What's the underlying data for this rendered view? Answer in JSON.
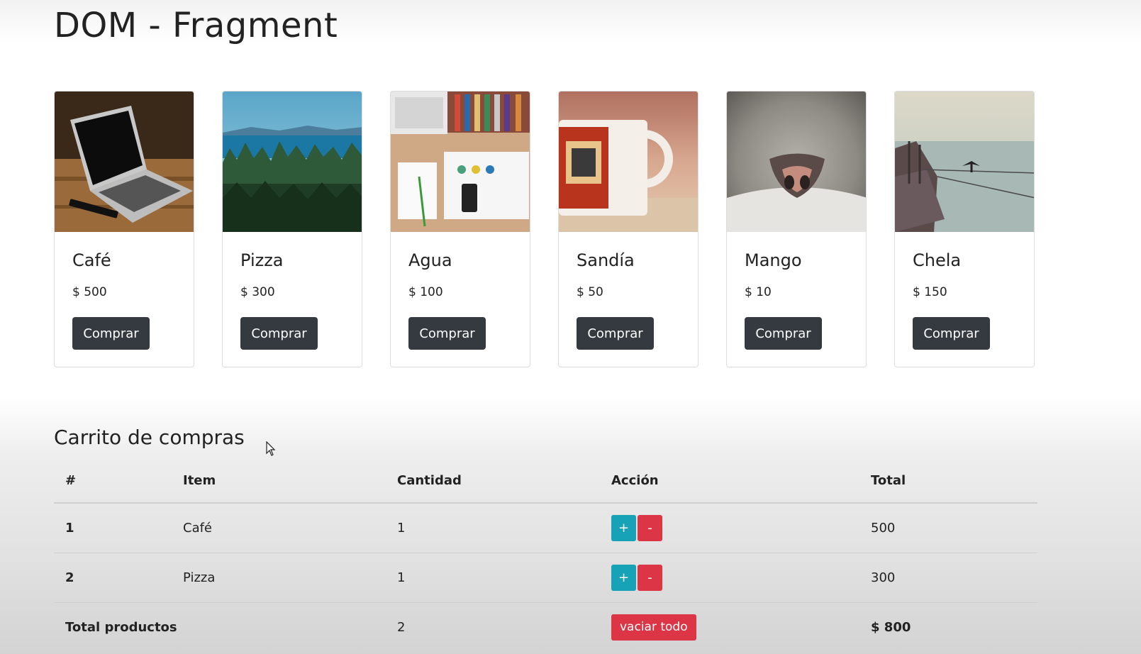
{
  "page_title": "DOM - Fragment",
  "products": [
    {
      "title": "Café",
      "price": "$ 500",
      "button": "Comprar",
      "image": "laptop-on-desk"
    },
    {
      "title": "Pizza",
      "price": "$ 300",
      "button": "Comprar",
      "image": "forest-and-sea"
    },
    {
      "title": "Agua",
      "price": "$ 100",
      "button": "Comprar",
      "image": "desk-flatlay"
    },
    {
      "title": "Sandía",
      "price": "$ 50",
      "button": "Comprar",
      "image": "coffee-mug"
    },
    {
      "title": "Mango",
      "price": "$ 10",
      "button": "Comprar",
      "image": "cat-nose"
    },
    {
      "title": "Chela",
      "price": "$ 150",
      "button": "Comprar",
      "image": "boat-on-lake"
    }
  ],
  "cart": {
    "title": "Carrito de compras",
    "headers": [
      "#",
      "Item",
      "Cantidad",
      "Acción",
      "Total"
    ],
    "rows": [
      {
        "num": "1",
        "item": "Café",
        "qty": "1",
        "plus": "+",
        "minus": "-",
        "total": "500"
      },
      {
        "num": "2",
        "item": "Pizza",
        "qty": "1",
        "plus": "+",
        "minus": "-",
        "total": "300"
      }
    ],
    "footer": {
      "label": "Total productos",
      "qty": "2",
      "empty_button": "vaciar todo",
      "total": "$ 800"
    }
  },
  "colors": {
    "dark_button": "#343a40",
    "info": "#17a2b8",
    "danger": "#dc3545"
  }
}
